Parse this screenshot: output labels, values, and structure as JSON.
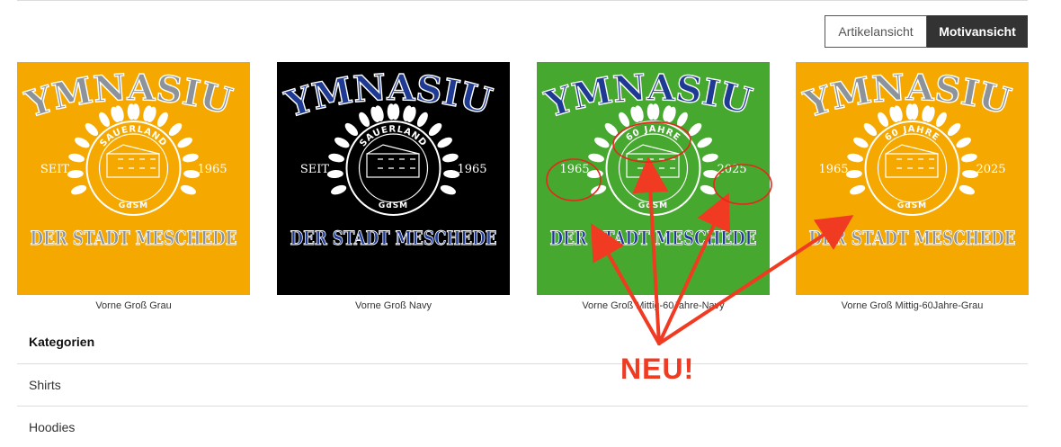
{
  "view_toggle": {
    "article_label": "Artikelansicht",
    "motif_label": "Motivansicht",
    "active": "Motivansicht"
  },
  "products": [
    {
      "caption": "Vorne Groß Grau",
      "bg": "#f5a800",
      "title_color": "#8d939a",
      "emblem_color": "#ffffff",
      "left": "SEIT",
      "right": "1965",
      "ring_top": "SAUERLAND",
      "ring_bottom": "GdSM",
      "title": "GYMNASIUM",
      "subtitle": "DER STADT MESCHEDE"
    },
    {
      "caption": "Vorne Groß Navy",
      "bg": "#000000",
      "title_color": "#1f3a93",
      "emblem_color": "#ffffff",
      "left": "SEIT",
      "right": "1965",
      "ring_top": "SAUERLAND",
      "ring_bottom": "GdSM",
      "title": "GYMNASIUM",
      "subtitle": "DER STADT MESCHEDE"
    },
    {
      "caption": "Vorne Groß Mittig-60Jahre-Navy",
      "bg": "#46a82f",
      "title_color": "#1f3a93",
      "emblem_color": "#ffffff",
      "left": "1965",
      "right": "2025",
      "ring_top": "60 JAHRE",
      "ring_bottom": "GdSM",
      "title": "GYMNASIUM",
      "subtitle": "DER STADT MESCHEDE"
    },
    {
      "caption": "Vorne Groß Mittig-60Jahre-Grau",
      "bg": "#f5a800",
      "title_color": "#8d939a",
      "emblem_color": "#ffffff",
      "left": "1965",
      "right": "2025",
      "ring_top": "60 JAHRE",
      "ring_bottom": "GdSM",
      "title": "GYMNASIUM",
      "subtitle": "DER STADT MESCHEDE"
    }
  ],
  "categories": {
    "title": "Kategorien",
    "items": [
      "Shirts",
      "Hoodies"
    ]
  },
  "annotation": {
    "label": "NEU!",
    "color": "#f03a21"
  }
}
